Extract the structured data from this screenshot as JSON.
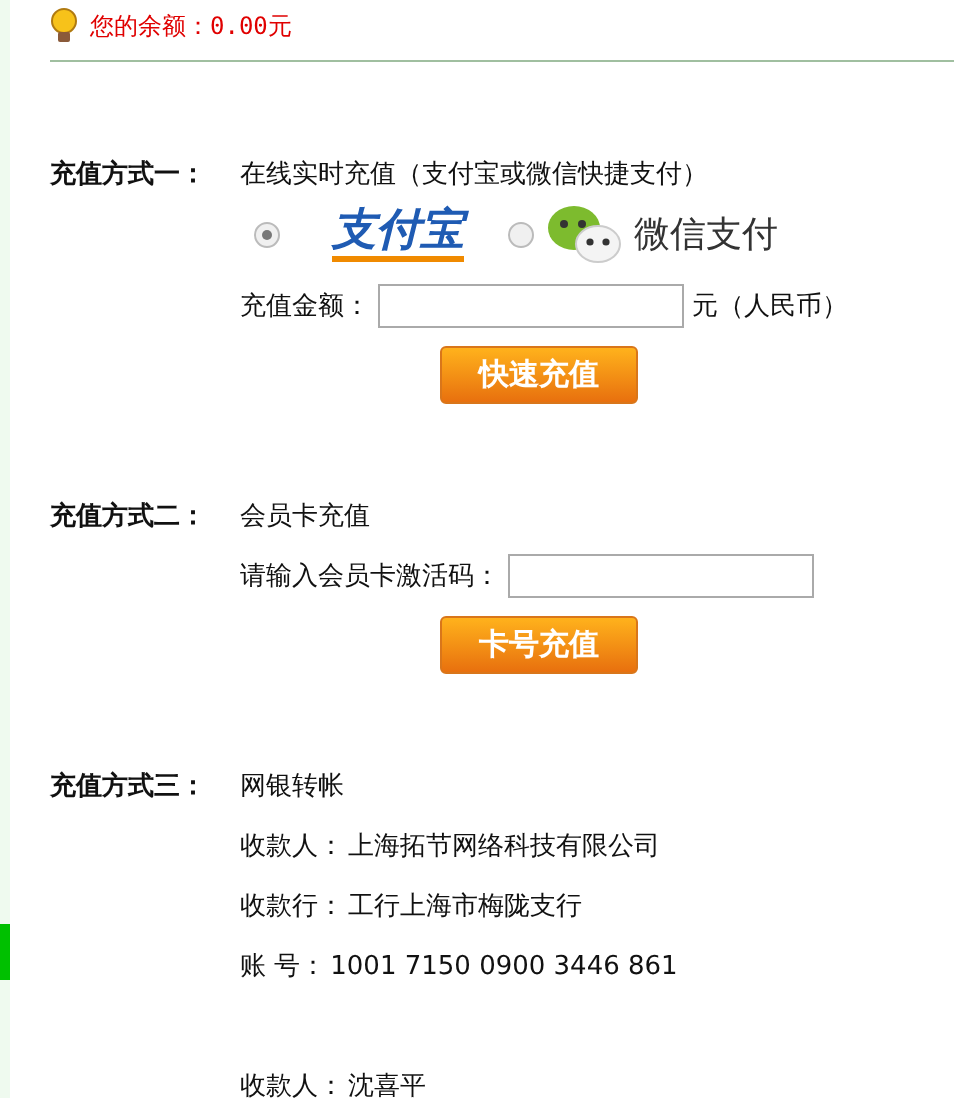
{
  "balance": {
    "label": "您的余额：",
    "amount": "0.00元"
  },
  "methods": [
    {
      "kind": "online",
      "label": "充值方式一：",
      "title": "在线实时充值（支付宝或微信快捷支付）",
      "options": [
        {
          "kind": "alipay",
          "text": "支付宝",
          "selected": true
        },
        {
          "kind": "wechat",
          "text": "微信支付",
          "selected": false
        }
      ],
      "amount_label": "充值金额：",
      "amount_unit": "元（人民币）",
      "button": "快速充值"
    },
    {
      "kind": "card",
      "label": "充值方式二：",
      "title": "会员卡充值",
      "code_label": "请输入会员卡激活码：",
      "button": "卡号充值"
    },
    {
      "kind": "bank",
      "label": "充值方式三：",
      "title": "网银转帐",
      "groups": [
        [
          {
            "label": "收款人：",
            "value": "上海拓节网络科技有限公司"
          },
          {
            "label": "收款行：",
            "value": "工行上海市梅陇支行"
          },
          {
            "label": "账 号：",
            "value": "1001 7150 0900 3446 861"
          }
        ],
        [
          {
            "label": "收款人：",
            "value": "沈喜平"
          }
        ]
      ]
    }
  ]
}
